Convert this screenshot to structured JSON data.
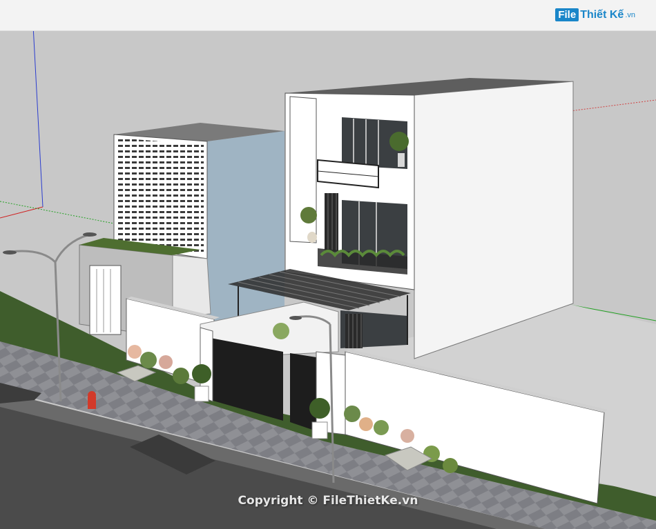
{
  "logo": {
    "badge": "File",
    "name": "Thiết Kế",
    "suffix": ".vn"
  },
  "watermark": "Copyright © FileThietKe.vn",
  "colors": {
    "sky": "#c8c8c8",
    "grass": "#3f5d2c",
    "sidewalk": "#8d8d92",
    "road": "#4a4a4a",
    "wall": "#ffffff",
    "glass": "#3b3f42",
    "neighbor_blue": "#9fb4c3",
    "accent": "#1a86c9"
  }
}
